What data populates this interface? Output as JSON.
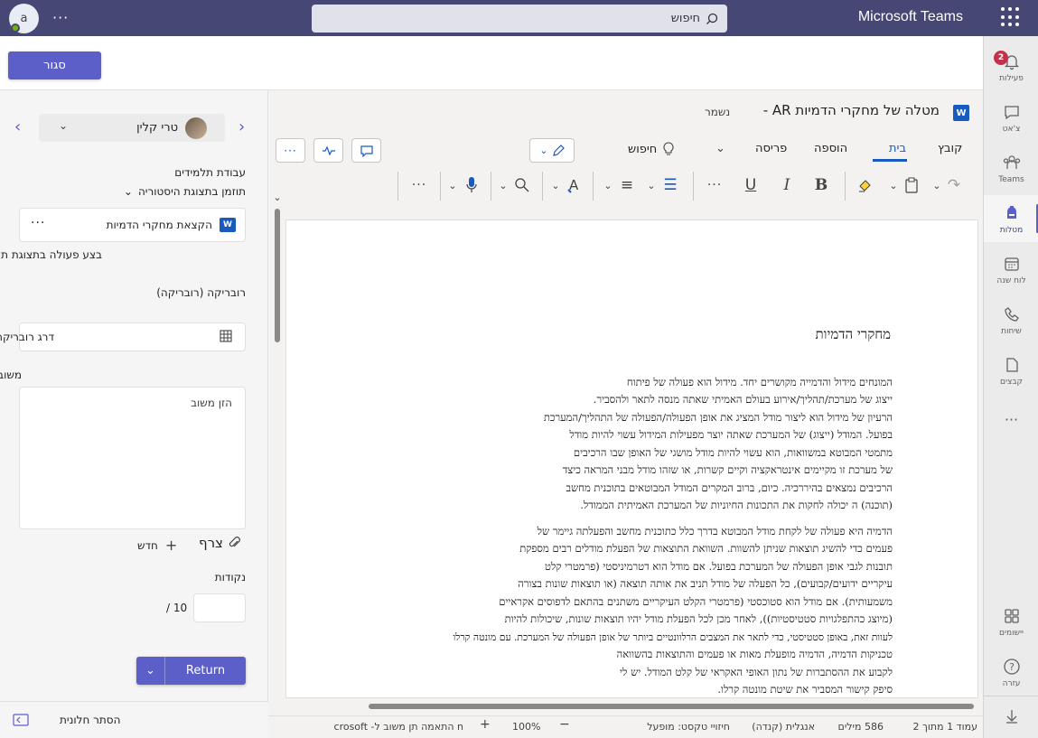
{
  "topbar": {
    "avatar_initial": "a",
    "more": "···",
    "search_label": "חיפוש",
    "app_title": "Microsoft Teams"
  },
  "rail": {
    "items": [
      {
        "label": "פעילות",
        "icon": "bell-icon",
        "badge": "2"
      },
      {
        "label": "צ'אט",
        "icon": "chat-icon"
      },
      {
        "label": "Teams",
        "icon": "teams-icon"
      },
      {
        "label": "מטלות",
        "icon": "assignments-icon"
      },
      {
        "label": "לוח שנה",
        "icon": "calendar-icon"
      },
      {
        "label": "שיחות",
        "icon": "phone-icon"
      },
      {
        "label": "קבצים",
        "icon": "files-icon"
      },
      {
        "label": "···",
        "icon": "more-icon"
      },
      {
        "label": "יישומים",
        "icon": "apps-icon"
      },
      {
        "label": "עזרה",
        "icon": "help-icon"
      }
    ]
  },
  "header": {
    "close_label": "סגור"
  },
  "grading": {
    "student_name": "טרי קלין",
    "student_work_label": "עבודת תלמידים",
    "history_label": "תוזמן בתצוגת היסטוריה",
    "attachment_name": "הקצאת מחקרי הדמיות",
    "attachment_more": "···",
    "action_label": "בצע פעולה בתצוגת תלמיד",
    "rubric_label": "רובריקה (רובריקה)",
    "rubric_value": "דרג רובריקה",
    "feedback_label": "משוב",
    "feedback_placeholder": "הזן משוב",
    "attach_label": "צרף",
    "new_label": "חדש",
    "points_label": "נקודות",
    "points_total": "/ 10",
    "return_label": "Return",
    "hide_panel_label": "הסתר חלונית"
  },
  "word": {
    "doc_title": "מטלה של מחקרי הדמיות AR -",
    "saved": "נשמר",
    "app_letter": "W",
    "tabs": [
      "קובץ",
      "בית",
      "הוספה",
      "פריסה"
    ],
    "active_tab": "בית",
    "search_label": "חיפוש",
    "document": {
      "heading": "מחקרי הדמיות",
      "para1": [
        "המונחים מידול והדמייה מקושרים יחד. מידול הוא פעולה של פיתוח",
        "ייצוג של מערכת/תהליך/אירוע בעולם האמיתי שאתה מנסה לתאר ולהסביר.",
        "הרעיון של מידול הוא ליצור מודל המציג את אופן הפעולה/הפעולה של התהליך/המערכת",
        "בפועל. המודל (ייצוג) של המערכת שאתה יוצר מפעילות המידול עשוי להיות מודל",
        "מתמטי המבוטא במשוואות, הוא עשוי להיות מודל מושגי של האופן שבו הרכיבים",
        "של מערכת זו מקיימים אינטראקציה וקיים קשרות, או שזהו מודל מבני המראה כיצד",
        "הרכיבים נמצאים בהיררכיה. כיום, ברוב המקרים המודל המבוטאים בתוכנית מחשב",
        "(תוכנה) ה יכולה לחקות את התכונות החיוניות של המערכת האמיתית הממודל."
      ],
      "para2": [
        "הדמיה היא פעולה של לקחת מודל המבוטא בדרך כלל כתוכנית מחשב והפעלתה גיימר של",
        "פעמים כדי להשיג תוצאות שניתן להשוות. השוואת התוצאות של הפעלת מודלים רבים מספקת",
        "תובנות לגבי אופן הפעולה של המערכת בפועל. אם מודל הוא דטרמיניסטי (פרמטרי קלט",
        "עיקריים ידועים/קבועים), כל הפעלה של מודל תניב את אותה תוצאה (או תוצאות שונות בצורה",
        "משמעותית). אם מודל הוא סטוכסטי (פרמטרי הקלט העיקריים משתנים בהתאם לדפוסים אקראיים",
        "(מיוצג כהתפלגויות סטטיסטיות)), לאחר מכן לכל הפעלת מודל יהיו תוצאות שונות, שיכולות להיות",
        "לעוות זאת, באופן סטטיסטי, כדי לתאר את המצבים הרלוונטיים ביותר של אופן הפעולה של המערכת. עם מונטה קרלו",
        "טכניקות הדמיה, הדמיה מופעלת מאות או פעמים והתוצאות בהשוואה",
        "לקבוע את ההסתברות של נתון האופי האקראי של קלט המודל. יש לי",
        "סיפק קישור המסביר את שיטת מונטה קרלו."
      ]
    },
    "status": {
      "page": "עמוד 1 מתוך 2",
      "words": "586 מילים",
      "language": "אנגלית (קנדה)",
      "text_predictions": "חיזויי טקסט: מופעל",
      "zoom": "100%",
      "feedback": "n התאמה תן משוב ל- Microsoft"
    }
  },
  "colors": {
    "teams_header": "#464775",
    "brand": "#5b5fc7",
    "word_blue": "#185abd",
    "badge": "#c4314b"
  }
}
